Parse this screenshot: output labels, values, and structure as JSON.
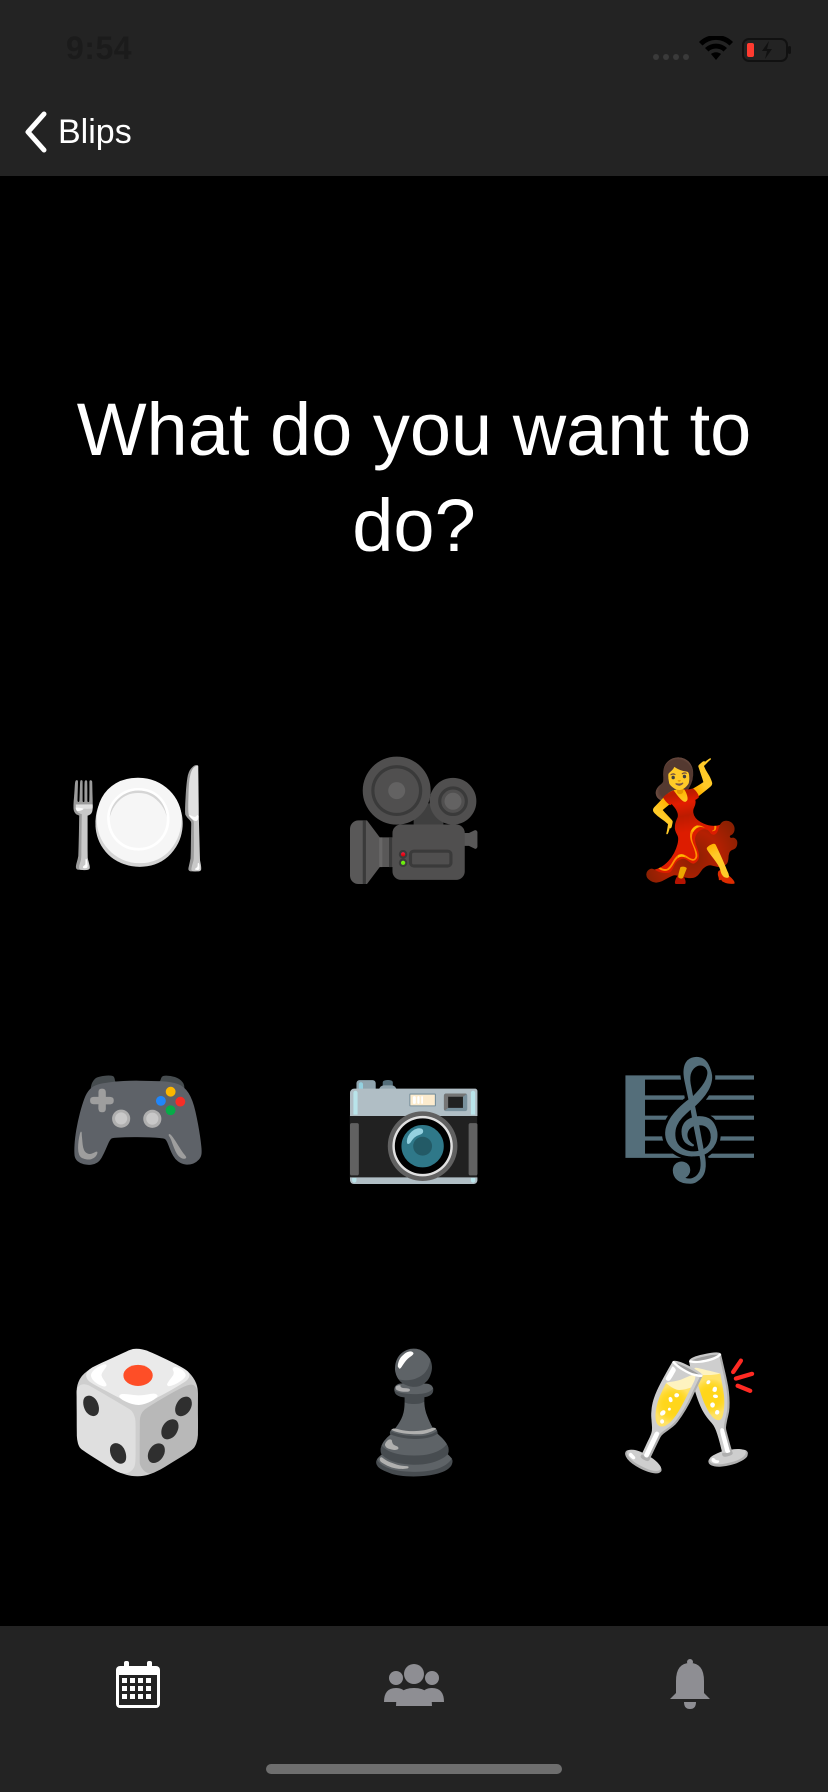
{
  "status_bar": {
    "time": "9:54"
  },
  "nav": {
    "back_label": "Blips"
  },
  "headline": "What do you want to do?",
  "activities": [
    {
      "name": "dining",
      "glyph": "🍽️"
    },
    {
      "name": "movies",
      "glyph": "🎥"
    },
    {
      "name": "dancing",
      "glyph": "💃"
    },
    {
      "name": "gaming",
      "glyph": "🎮"
    },
    {
      "name": "photography",
      "glyph": "📷"
    },
    {
      "name": "music",
      "glyph": "🎼"
    },
    {
      "name": "board-games",
      "glyph": "🎲"
    },
    {
      "name": "chess",
      "glyph": "♟️"
    },
    {
      "name": "drinks",
      "glyph": "🥂"
    }
  ],
  "tabs": [
    {
      "name": "calendar",
      "icon": "calendar-icon",
      "active": true
    },
    {
      "name": "friends",
      "icon": "group-icon",
      "active": false
    },
    {
      "name": "notifications",
      "icon": "bell-icon",
      "active": false
    }
  ],
  "colors": {
    "bar_background": "#232323",
    "page_background": "#000000",
    "active_tab": "#ffffff",
    "inactive_tab": "#8e8e93",
    "battery_low": "#ff3b30"
  }
}
